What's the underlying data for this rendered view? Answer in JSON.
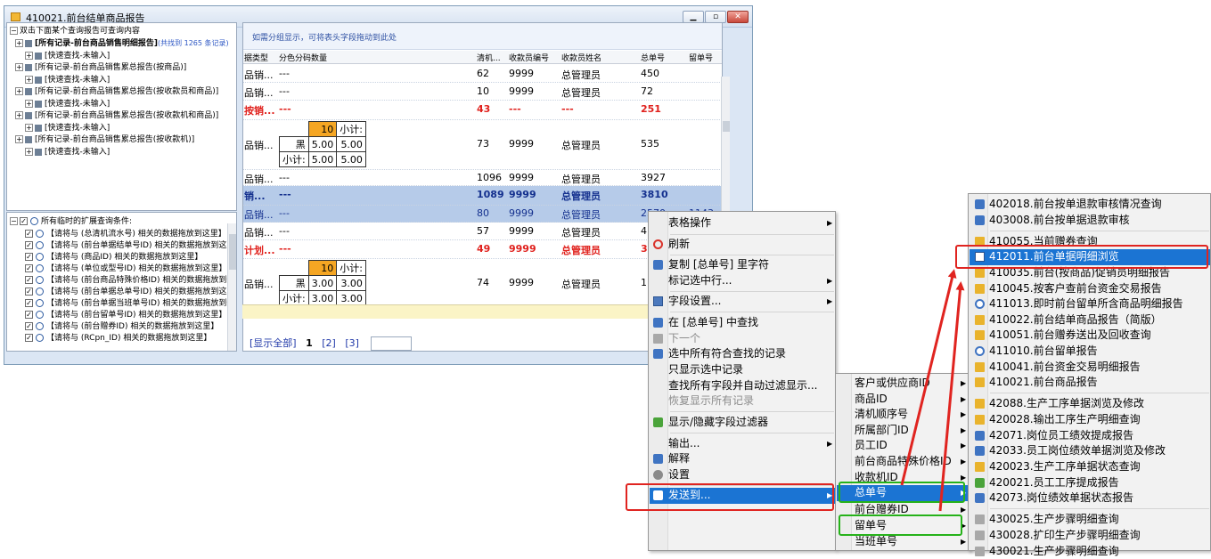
{
  "window": {
    "title": "410021.前台结单商品报告"
  },
  "tree": {
    "hint": "双击下面某个查询报告可查询内容",
    "items": [
      {
        "label": "[所有记录-前台商品销售明细报告]",
        "extra": "(共找到 1265 条记录)"
      },
      {
        "label": "[快速查找-未输入]"
      },
      {
        "label": "[所有记录-前台商品销售累总报告(按商品)]"
      },
      {
        "label": "[快速查找-未输入]"
      },
      {
        "label": "[所有记录-前台商品销售累总报告(按收款员和商品)]"
      },
      {
        "label": "[快速查找-未输入]"
      },
      {
        "label": "[所有记录-前台商品销售累总报告(按收款机和商品)]"
      },
      {
        "label": "[快速查找-未输入]"
      },
      {
        "label": "[所有记录-前台商品销售累总报告(按收款机)]"
      },
      {
        "label": "[快速查找-未输入]"
      }
    ]
  },
  "conditions": {
    "header": "所有临时的扩展查询条件:",
    "items": [
      "【请将与 (总清机流水号) 相关的数据拖放到这里】",
      "【请将与 (前台单据结单号ID) 相关的数据拖放到这里】",
      "【请将与 (商品ID) 相关的数据拖放到这里】",
      "【请将与 (单位或型号ID) 相关的数据拖放到这里】",
      "【请将与 (前台商品特殊价格ID) 相关的数据拖放到这里】",
      "【请将与 (前台单据总单号ID) 相关的数据拖放到这里】",
      "【请将与 (前台单据当班单号ID) 相关的数据拖放到这里】",
      "【请将与 (前台留单号ID) 相关的数据拖放到这里】",
      "【请将与 (前台赠券ID) 相关的数据拖放到这里】",
      "【请将与 (RCpn_ID) 相关的数据拖放到这里】"
    ]
  },
  "grid": {
    "group_hint": "如需分组显示，可将表头字段拖动到此处",
    "columns": [
      "据类型",
      "分色分码数量",
      "清机...",
      "收款员编号",
      "收款员姓名",
      "总单号",
      "留单号"
    ],
    "rows": [
      {
        "c0": "品销...",
        "c1": "---",
        "c2": "62",
        "c3": "9999",
        "c4": "总管理员",
        "c5": "450",
        "c6": ""
      },
      {
        "c0": "品销...",
        "c1": "---",
        "c2": "10",
        "c3": "9999",
        "c4": "总管理员",
        "c5": "72",
        "c6": ""
      },
      {
        "c0": "按销...",
        "c1": "---",
        "c2": "43",
        "c3": "---",
        "c4": "---",
        "c5": "251",
        "c6": ""
      },
      {
        "c0": "品销...",
        "c1": "",
        "c2": "73",
        "c3": "9999",
        "c4": "总管理员",
        "c5": "535",
        "c6": ""
      },
      {
        "c0": "品销...",
        "c1": "---",
        "c2": "1096",
        "c3": "9999",
        "c4": "总管理员",
        "c5": "3927",
        "c6": ""
      },
      {
        "c0": "销...",
        "c1": "---",
        "c2": "1089",
        "c3": "9999",
        "c4": "总管理员",
        "c5": "3810",
        "c6": ""
      },
      {
        "c0": "品销...",
        "c1": "---",
        "c2": "80",
        "c3": "9999",
        "c4": "总管理员",
        "c5": "2570",
        "c6": "1143"
      },
      {
        "c0": "品销...",
        "c1": "---",
        "c2": "57",
        "c3": "9999",
        "c4": "总管理员",
        "c5": "4...",
        "c6": ""
      },
      {
        "c0": "计划...",
        "c1": "---",
        "c2": "49",
        "c3": "9999",
        "c4": "总管理员",
        "c5": "3",
        "c6": ""
      },
      {
        "c0": "品销...",
        "c1": "",
        "c2": "74",
        "c3": "9999",
        "c4": "总管理员",
        "c5": "1",
        "c6": ""
      }
    ],
    "sub1": {
      "head": "10",
      "subtotal": "小计:",
      "color": "黑",
      "v1": "5.00",
      "v2": "5.00",
      "v3": "5.00",
      "v4": "5.00"
    },
    "sub2": {
      "head": "10",
      "subtotal": "小计:",
      "color": "黑",
      "v1": "3.00",
      "v2": "3.00",
      "v3": "3.00",
      "v4": "3.00"
    }
  },
  "pager": {
    "show_all": "[显示全部]",
    "p1": "1",
    "p2": "[2]",
    "p3": "[3]"
  },
  "menu1": {
    "items": [
      "表格操作",
      "刷新",
      "复制 [总单号] 里字符",
      "标记选中行...",
      "字段设置...",
      "在 [总单号] 中查找",
      "下一个",
      "选中所有符合查找的记录",
      "只显示选中记录",
      "查找所有字段并自动过滤显示...",
      "恢复显示所有记录",
      "显示/隐藏字段过滤器",
      "输出...",
      "解释",
      "设置",
      "发送到..."
    ]
  },
  "menu2": {
    "items": [
      "客户或供应商ID",
      "商品ID",
      "清机顺序号",
      "所属部门ID",
      "员工ID",
      "前台商品特殊价格ID",
      "收款机ID",
      "总单号",
      "前台赠券ID",
      "留单号",
      "当班单号"
    ]
  },
  "menu3": {
    "items": [
      "402018.前台按单退款审核情况查询",
      "403008.前台按单据退款审核",
      "410055.当前赠券查询",
      "412011.前台单据明细浏览",
      "410035.前台(按商品)促销员明细报告",
      "410045.按客户查前台资金交易报告",
      "411013.即时前台留单所含商品明细报告",
      "410022.前台结单商品报告（简版）",
      "410051.前台赠券送出及回收查询",
      "411010.前台留单报告",
      "410041.前台资金交易明细报告",
      "410021.前台商品报告",
      "42088.生产工序单据浏览及修改",
      "420028.输出工序生产明细查询",
      "42071.岗位员工绩效提成报告",
      "42033.员工岗位绩效单据浏览及修改",
      "420023.生产工序单据状态查询",
      "420021.员工工序提成报告",
      "42073.岗位绩效单据状态报告",
      "430025.生产步骤明细查询",
      "430028.扩印生产步骤明细查询",
      "430021.生产步骤明细查询"
    ]
  },
  "colors": {
    "highlight": "#1b74d3",
    "annotation_red": "#e02420",
    "annotation_green": "#26b21a",
    "total_row_red": "#e0211d",
    "subtotal_orange": "#f5a623"
  }
}
